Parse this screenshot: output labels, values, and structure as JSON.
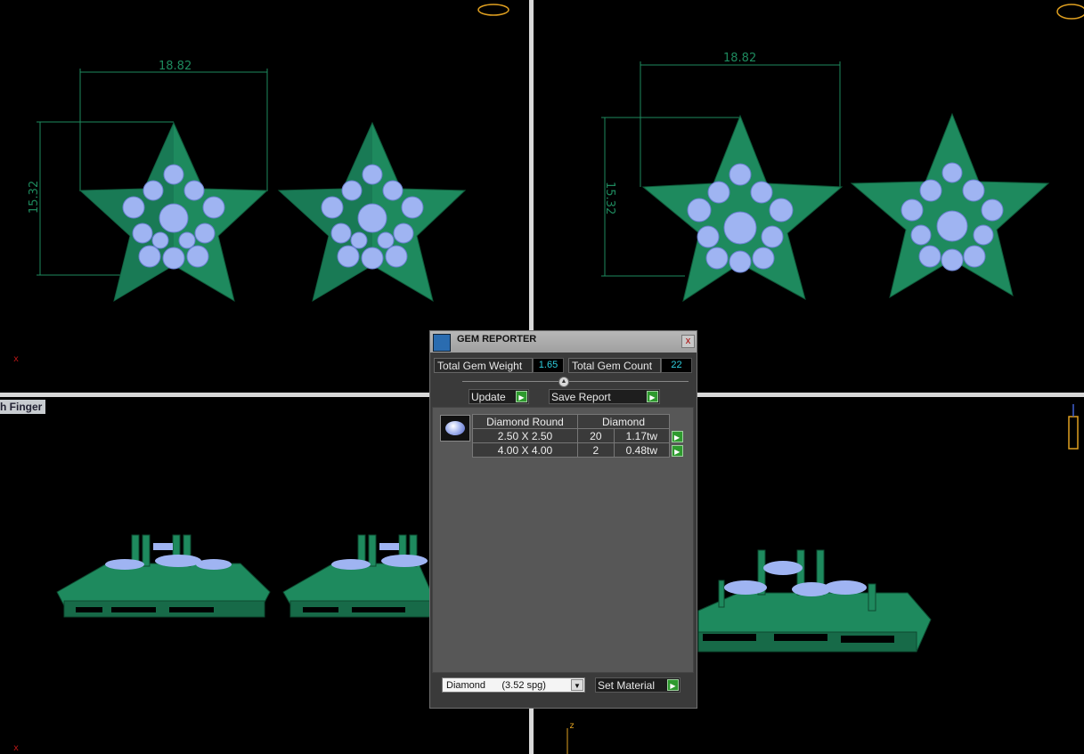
{
  "viewports": {
    "top_left": {
      "dim_width": "18.82",
      "dim_height": "15.32"
    },
    "top_right": {
      "dim_width": "18.82",
      "dim_height": "15.32"
    },
    "bottom_left": {
      "label": "h Finger"
    },
    "axis": {
      "x": "x",
      "z": "z"
    }
  },
  "dialog": {
    "title": "GEM REPORTER",
    "close": "x",
    "total_weight_label": "Total Gem Weight",
    "total_weight_value": "1.65",
    "total_count_label": "Total Gem Count",
    "total_count_value": "22",
    "update_label": "Update",
    "save_report_label": "Save Report",
    "arrow_glyph": "▶",
    "table": {
      "col1_header": "Diamond Round",
      "col2_header": "Diamond",
      "rows": [
        {
          "size": "2.50 X 2.50",
          "count": "20",
          "weight": "1.17tw"
        },
        {
          "size": "4.00 X 4.00",
          "count": "2",
          "weight": "0.48tw"
        }
      ]
    },
    "material_select_value": "Diamond      (3.52 spg)",
    "set_material_label": "Set Material"
  },
  "colors": {
    "metal_green": "#1e8a5e",
    "gem_blue": "#9fb4f2",
    "value_cyan": "#2fd0e0"
  }
}
